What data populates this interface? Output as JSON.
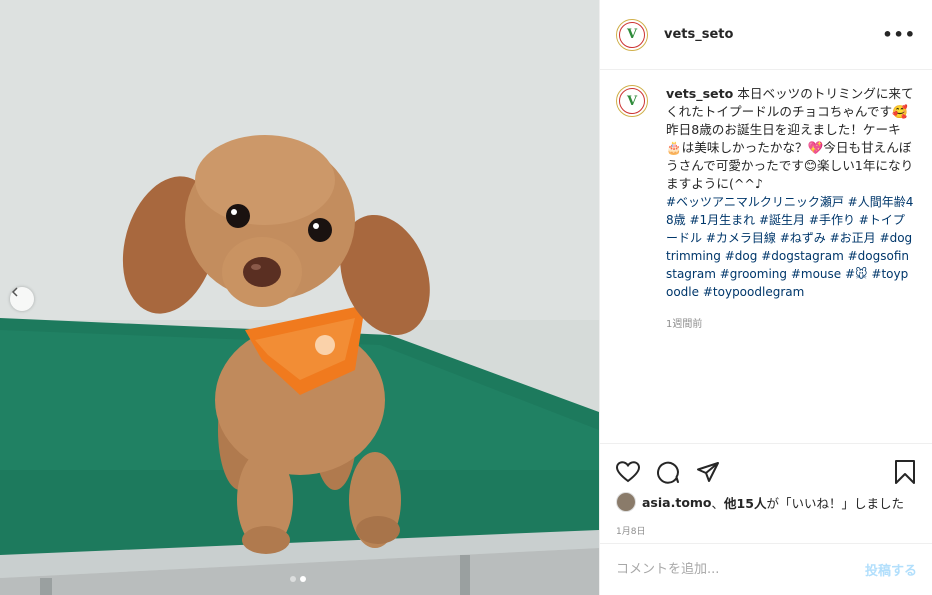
{
  "post": {
    "username": "vets_seto",
    "more_label": "•••",
    "avatar_letter": "V"
  },
  "caption": {
    "username": "vets_seto",
    "text": "本日ベッツのトリミングに来てくれたトイプードルのチョコちゃんです🥰昨日8歳のお誕生日を迎えました！ケーキ🎂は美味しかったかな？💖今日も甘えんぼうさんで可愛かったです😊楽しい1年になりますように(^^♪",
    "hashtags": [
      "#ベッツアニマルクリニック瀬戸",
      "#人間年齢48歳",
      "#1月生まれ",
      "#誕生月",
      "#手作り",
      "#トイプードル",
      "#カメラ目線",
      "#ねずみ",
      "#お正月",
      "#dogtrimming",
      "#dog",
      "#dogstagram",
      "#dogsofinstagram",
      "#grooming",
      "#mouse",
      "#🐭",
      "#toypoodle",
      "#toypoodlegram"
    ],
    "time_ago": "1週間前"
  },
  "likes": {
    "user": "asia.tomo",
    "sep": "、",
    "others": "他15人",
    "suffix": "が「いいね！」しました"
  },
  "date": "1月8日",
  "comment": {
    "placeholder": "コメントを追加...",
    "post_label": "投稿する"
  },
  "carousel": {
    "count": 2,
    "active_index": 1
  },
  "colors": {
    "table_top": "#1e7a5e",
    "bandana": "#f07a1e",
    "link": "#00376b"
  }
}
